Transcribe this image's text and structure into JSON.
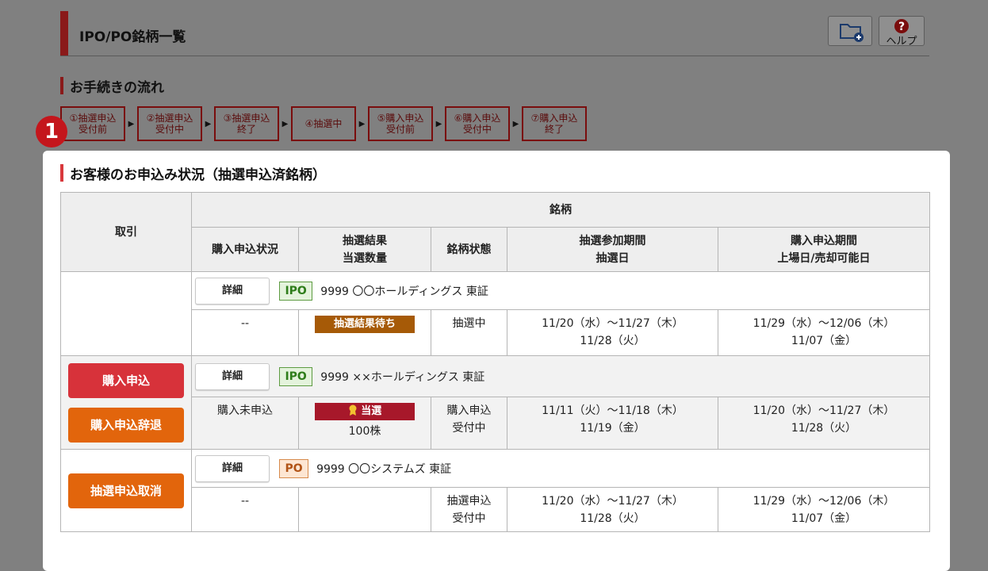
{
  "header": {
    "title": "IPO/PO銘柄一覧",
    "folder_icon": "folder-add-icon",
    "help_label": "ヘルプ",
    "help_icon": "question-circle-icon"
  },
  "flow": {
    "title": "お手続きの流れ",
    "steps": [
      {
        "line1": "①抽選申込",
        "line2": "受付前"
      },
      {
        "line1": "②抽選申込",
        "line2": "受付中"
      },
      {
        "line1": "③抽選申込",
        "line2": "終了"
      },
      {
        "line1": "④抽選中",
        "line2": ""
      },
      {
        "line1": "⑤購入申込",
        "line2": "受付前"
      },
      {
        "line1": "⑥購入申込",
        "line2": "受付中"
      },
      {
        "line1": "⑦購入申込",
        "line2": "終了"
      }
    ],
    "arrow": "▶"
  },
  "badge": "1",
  "status": {
    "title": "お客様のお申込み状況（抽選申込済銘柄）",
    "headers": {
      "trade": "取引",
      "issue": "銘柄",
      "purchase_status": "購入申込状況",
      "lottery_result_1": "抽選結果",
      "lottery_result_2": "当選数量",
      "issue_state": "銘柄状態",
      "lottery_period_1": "抽選参加期間",
      "lottery_period_2": "抽選日",
      "purchase_period_1": "購入申込期間",
      "purchase_period_2": "上場日/売却可能日"
    },
    "rows": [
      {
        "detail": "詳細",
        "tag": "IPO",
        "name": "9999 〇〇ホールディングス 東証",
        "purchase_status": "--",
        "result_pill": "抽選結果待ち",
        "quantity": "",
        "state_1": "抽選中",
        "state_2": "",
        "lottery_period": "11/20（水）～11/27（木）",
        "lottery_date": "11/28（火）",
        "purchase_period": "11/29（水）～12/06（木）",
        "listing_date": "11/07（金）"
      },
      {
        "detail": "詳細",
        "tag": "IPO",
        "name": "9999 ××ホールディングス 東証",
        "action_1": "購入申込",
        "action_2": "購入申込辞退",
        "purchase_status": "購入未申込",
        "result_pill": "当選",
        "result_icon": "award-medal-icon",
        "quantity": "100株",
        "state_1": "購入申込",
        "state_2": "受付中",
        "lottery_period": "11/11（火）～11/18（木）",
        "lottery_date": "11/19（金）",
        "purchase_period": "11/20（水）～11/27（木）",
        "listing_date": "11/28（火）"
      },
      {
        "detail": "詳細",
        "tag": "PO",
        "name": "9999 〇〇システムズ 東証",
        "action_1": "抽選申込取消",
        "purchase_status": "--",
        "quantity": "",
        "state_1": "抽選申込",
        "state_2": "受付中",
        "lottery_period": "11/20（水）～11/27（木）",
        "lottery_date": "11/28（火）",
        "purchase_period": "11/29（水）～12/06（木）",
        "listing_date": "11/07（金）"
      }
    ]
  },
  "colors": {
    "overlay": "#808080",
    "accent": "#8a1a1a",
    "badge": "#c4161c",
    "win": "#a7182a",
    "wait": "#a65a07",
    "apply": "#d7323a",
    "decline": "#e2650c"
  }
}
